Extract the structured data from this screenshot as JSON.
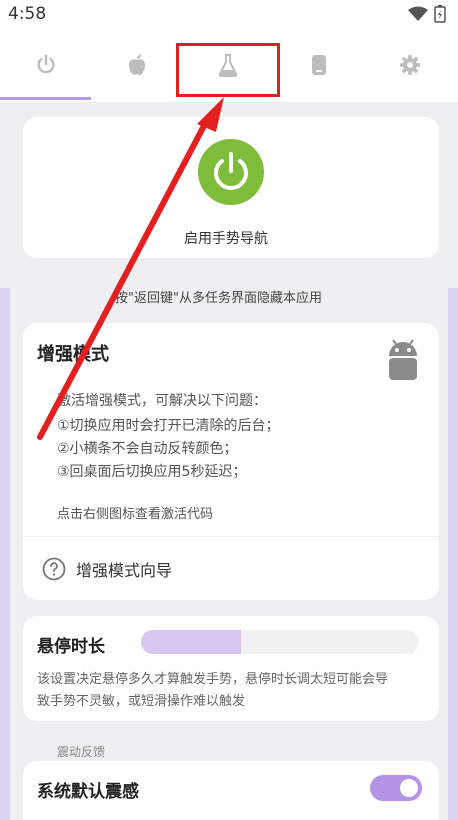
{
  "status_bar": {
    "time": "4:58"
  },
  "tabs": [
    {
      "icon": "power-icon",
      "active": true
    },
    {
      "icon": "apple-icon"
    },
    {
      "icon": "flask-icon"
    },
    {
      "icon": "phone-icon"
    },
    {
      "icon": "gear-icon"
    }
  ],
  "gesture_card": {
    "label": "启用手势导航"
  },
  "hint_text": "按\"返回键\"从多任务界面隐藏本应用",
  "enhanced_card": {
    "title": "增强模式",
    "description": "激活增强模式，可解决以下问题：",
    "items": [
      "①切换应用时会打开已清除的后台；",
      "②小横条不会自动反转颜色；",
      "③回桌面后切换应用5秒延迟；"
    ],
    "hint": "点击右侧图标查看激活代码",
    "guide_label": "增强模式向导"
  },
  "hover_card": {
    "title": "悬停时长",
    "progress_fraction": 0.36,
    "desc_line1": "该设置决定悬停多久才算触发手势，悬停时长调太短可能会导",
    "desc_line2": "致手势不灵敏，或短滑操作难以触发"
  },
  "vibration": {
    "section_label": "震动反馈",
    "system_default_label": "系统默认震感",
    "toggle_on": true
  },
  "colors": {
    "accent": "#b593e6",
    "power_green": "#7dbd3a",
    "annotation_red": "#e41f1f"
  }
}
